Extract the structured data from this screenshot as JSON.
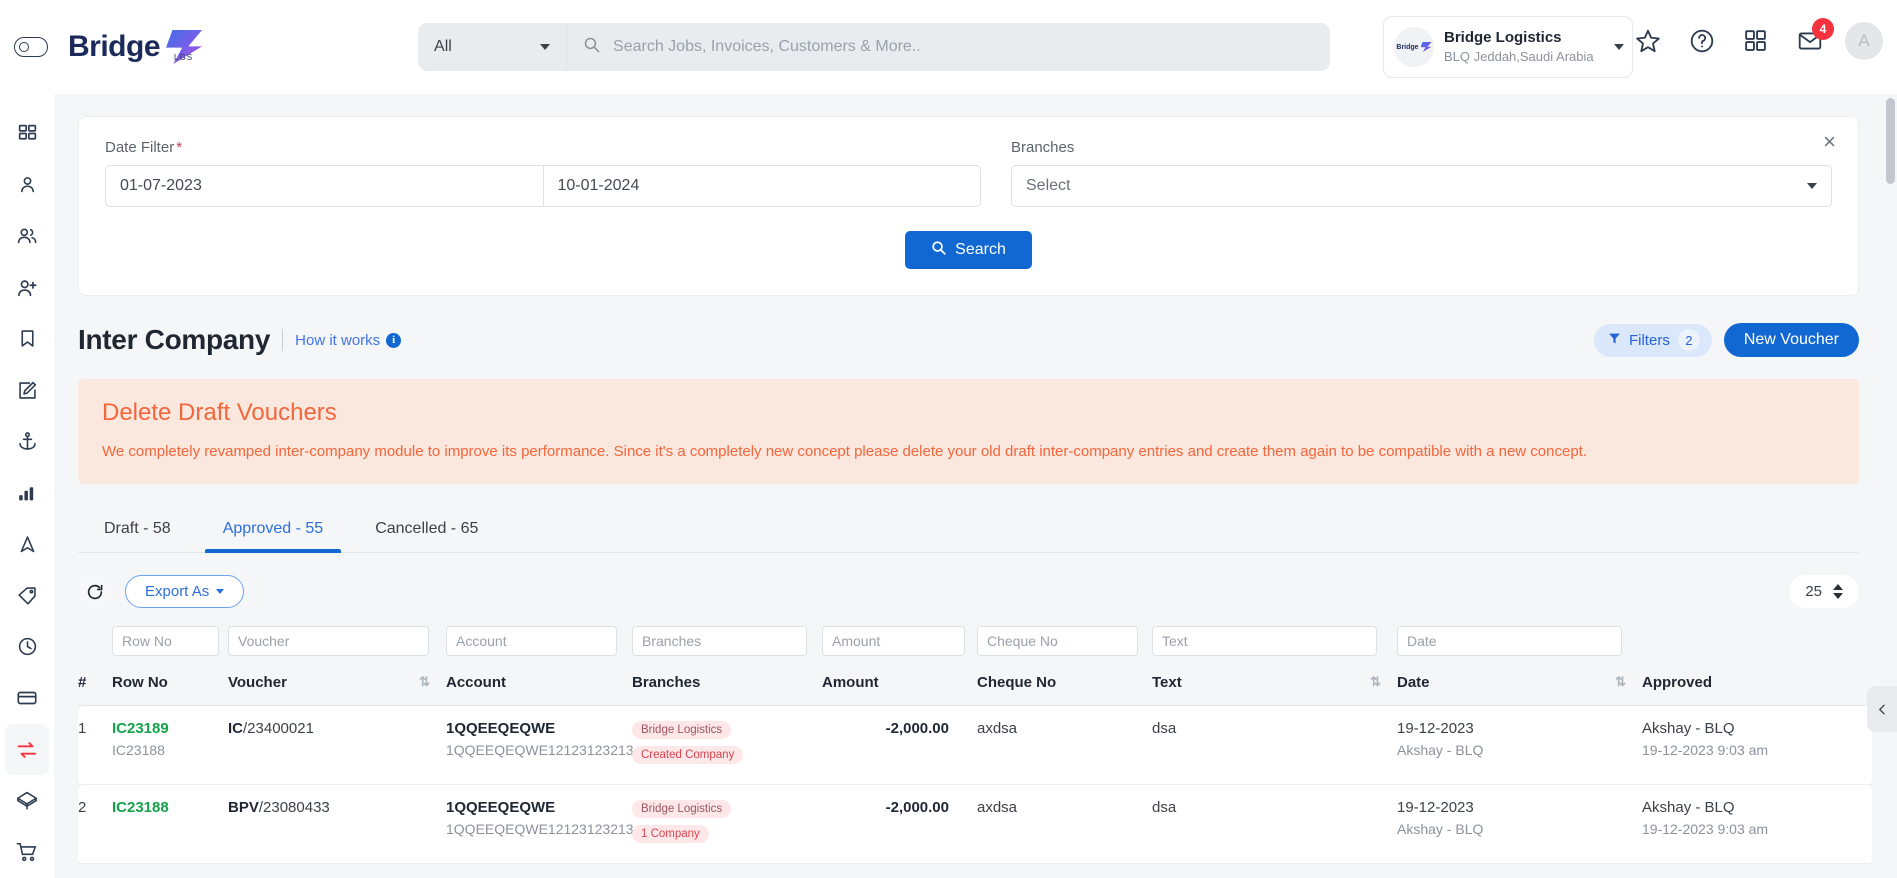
{
  "header": {
    "logo_text": "Bridge",
    "logo_sub": "LGS",
    "search_scope": "All",
    "search_placeholder": "Search Jobs, Invoices, Customers & More..",
    "org_avatar_text": "Bridge",
    "org_name": "Bridge Logistics",
    "org_location": "BLQ Jeddah,Saudi Arabia",
    "mail_badge": "4",
    "avatar_initial": "A",
    "icons": {
      "eye_toggle": "eye-toggle-icon",
      "search": "search-icon",
      "star": "star-icon",
      "help": "help-circle-icon",
      "apps": "apps-grid-icon",
      "mail": "envelope-icon"
    }
  },
  "sidebar": {
    "items": [
      {
        "name": "dashboard",
        "icon": "grid-icon",
        "active": false
      },
      {
        "name": "user",
        "icon": "user-icon",
        "active": false
      },
      {
        "name": "users",
        "icon": "users-icon",
        "active": false
      },
      {
        "name": "add-user",
        "icon": "user-plus-icon",
        "active": false
      },
      {
        "name": "bookmarks",
        "icon": "bookmark-icon",
        "active": false
      },
      {
        "name": "edit",
        "icon": "edit-square-icon",
        "active": false
      },
      {
        "name": "shipping",
        "icon": "anchor-icon",
        "active": false
      },
      {
        "name": "reports",
        "icon": "bar-chart-icon",
        "active": false
      },
      {
        "name": "navigation",
        "icon": "navigation-arrow-icon",
        "active": false
      },
      {
        "name": "tags",
        "icon": "tag-icon",
        "active": false
      },
      {
        "name": "history",
        "icon": "clock-icon",
        "active": false
      },
      {
        "name": "payments",
        "icon": "credit-card-icon",
        "active": false
      },
      {
        "name": "inter-company",
        "icon": "transfer-arrows-icon",
        "active": true
      },
      {
        "name": "packages",
        "icon": "box-3d-icon",
        "active": false
      },
      {
        "name": "orders",
        "icon": "cart-icon",
        "active": false
      }
    ]
  },
  "filter_panel": {
    "date_label": "Date Filter",
    "required_mark": "*",
    "date_from": "01-07-2023",
    "date_to": "10-01-2024",
    "branches_label": "Branches",
    "branches_value": "Select",
    "search_button": "Search",
    "close_icon": "close-icon"
  },
  "page": {
    "title": "Inter Company",
    "how_it_works": "How it works",
    "info_icon_char": "i",
    "filters_label": "Filters",
    "filters_count": "2",
    "new_voucher_label": "New Voucher"
  },
  "alert": {
    "title": "Delete Draft Vouchers",
    "message": "We completely revamped inter-company module to improve its performance. Since it's a completely new concept please delete your old draft inter-company entries and create them again to be compatible with a new concept."
  },
  "tabs": [
    {
      "label": "Draft - 58",
      "active": false
    },
    {
      "label": "Approved - 55",
      "active": true
    },
    {
      "label": "Cancelled - 65",
      "active": false
    }
  ],
  "toolbar": {
    "refresh_icon": "refresh-icon",
    "export_label": "Export As",
    "page_size": "25"
  },
  "table": {
    "filters": {
      "row_no": "Row No",
      "voucher": "Voucher",
      "account": "Account",
      "branches": "Branches",
      "amount": "Amount",
      "cheque_no": "Cheque No",
      "text": "Text",
      "date": "Date"
    },
    "columns": {
      "index": "#",
      "row_no": "Row No",
      "voucher": "Voucher",
      "account": "Account",
      "branches": "Branches",
      "amount": "Amount",
      "cheque_no": "Cheque No",
      "text": "Text",
      "date": "Date",
      "approved": "Approved"
    },
    "rows": [
      {
        "index": "1",
        "row_no": "IC23189",
        "row_no_sub": "IC23188",
        "voucher_prefix": "IC",
        "voucher_number": "/23400021",
        "account": "1QQEEQEQWE",
        "account_sub": "1QQEEQEQWE12123123213...",
        "badge_primary": "Bridge Logistics",
        "badge_secondary": "Created Company",
        "amount": "-2,000.00",
        "cheque_no": "axdsa",
        "text": "dsa",
        "date": "19-12-2023",
        "date_sub": "Akshay - BLQ",
        "approved_by": "Akshay - BLQ",
        "approved_at": "19-12-2023 9:03 am"
      },
      {
        "index": "2",
        "row_no": "IC23188",
        "row_no_sub": "",
        "voucher_prefix": "BPV",
        "voucher_number": "/23080433",
        "account": "1QQEEQEQWE",
        "account_sub": "1QQEEQEQWE12123123213...",
        "badge_primary": "Bridge Logistics",
        "badge_secondary": "1 Company",
        "amount": "-2,000.00",
        "cheque_no": "axdsa",
        "text": "dsa",
        "date": "19-12-2023",
        "date_sub": "Akshay - BLQ",
        "approved_by": "Akshay - BLQ",
        "approved_at": "19-12-2023 9:03 am"
      }
    ]
  },
  "colors": {
    "primary_blue": "#1268d3",
    "link_blue": "#4274e8",
    "alert_orange": "#f4663b",
    "alert_bg": "#fae7dd",
    "green": "#14a34a",
    "badge_red": "#d6454f",
    "badge_bg": "#fde7e9",
    "notif_red": "#f5333f"
  }
}
